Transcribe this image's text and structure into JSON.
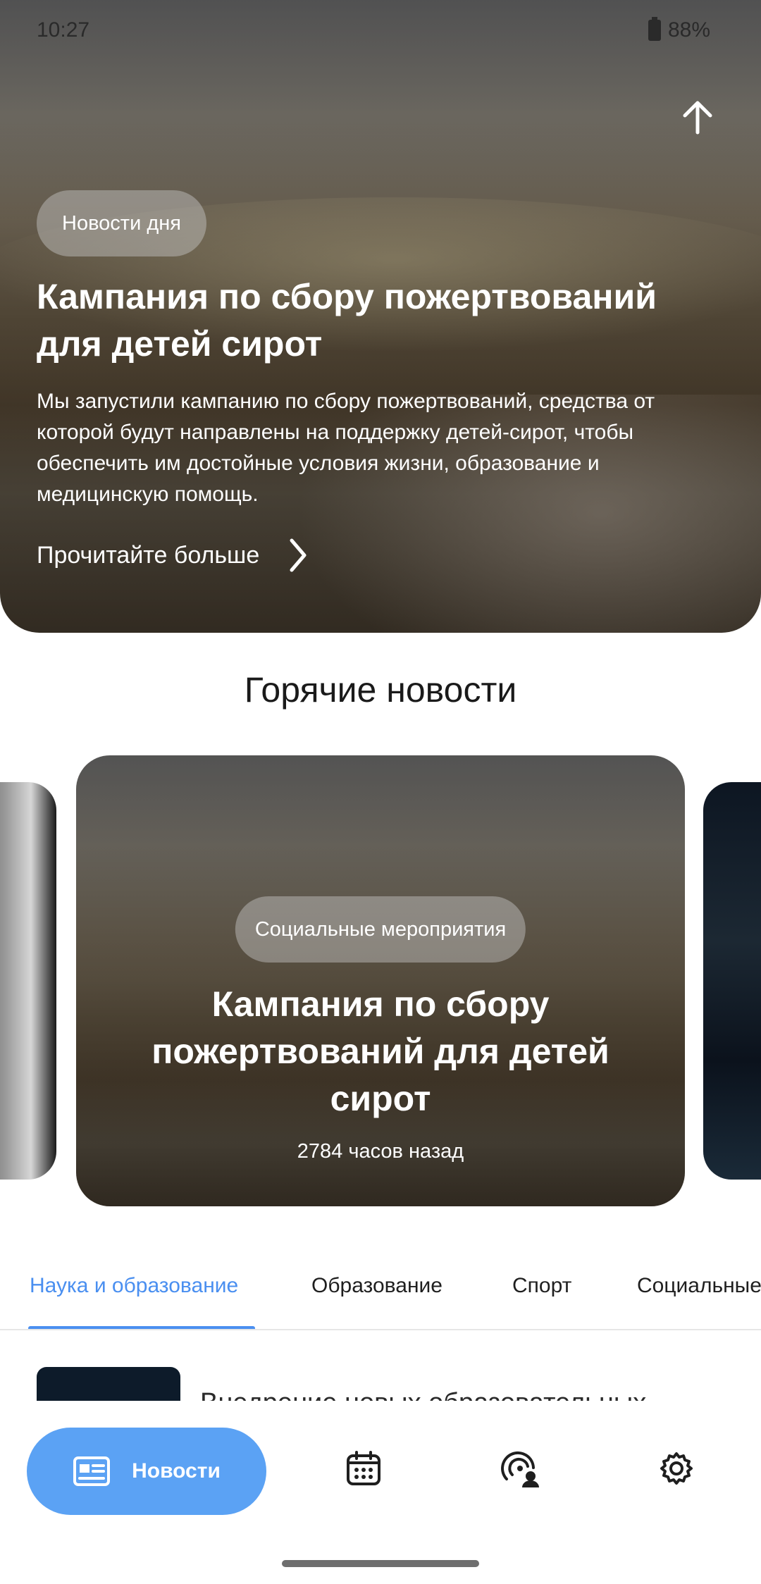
{
  "status_bar": {
    "time": "10:27",
    "battery": "88%"
  },
  "hero": {
    "chip": "Новости дня",
    "title": "Кампания по сбору пожертвований для детей сирот",
    "description": "Мы запустили кампанию по сбору пожертвований, средства от которой будут направлены на поддержку детей-сирот, чтобы обеспечить им достойные условия жизни, образование и медицинскую помощь.",
    "read_more": "Прочитайте больше"
  },
  "hot_news": {
    "title": "Горячие новости",
    "card": {
      "chip": "Социальные мероприятия",
      "title": "Кампания по сбору пожертвований для детей сирот",
      "time": "2784 часов назад"
    }
  },
  "tabs": [
    {
      "label": "Наука и образование",
      "active": true
    },
    {
      "label": "Образование",
      "active": false
    },
    {
      "label": "Спорт",
      "active": false
    },
    {
      "label": "Социальные",
      "active": false
    }
  ],
  "list": [
    {
      "title": "Внедрение новых образовательных"
    }
  ],
  "bottom_nav": {
    "active_label": "Новости",
    "items": [
      "news-icon",
      "calendar-icon",
      "broadcast-user-icon",
      "settings-icon"
    ]
  },
  "colors": {
    "accent": "#4a8ff0",
    "nav_active_bg": "#5ba2f4"
  }
}
